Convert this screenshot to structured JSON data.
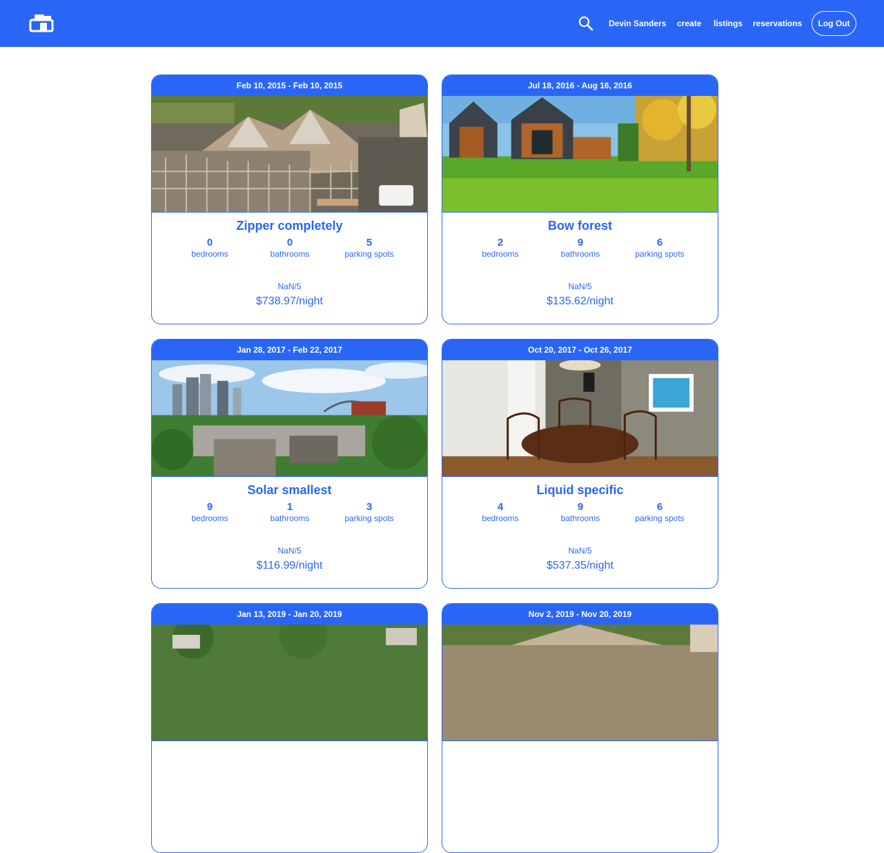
{
  "navbar": {
    "user_name": "Devin Sanders",
    "links": {
      "create": "create",
      "listings": "listings",
      "reservations": "reservations"
    },
    "logout_label": "Log Out",
    "accent_color": "#2a66f6"
  },
  "listings": [
    {
      "dates": "Feb 10, 2015 - Feb 10, 2015",
      "title": "Zipper completely",
      "bedrooms": "0",
      "bathrooms": "0",
      "parking": "5",
      "rating": "NaN/5",
      "price": "$738.97/night"
    },
    {
      "dates": "Jul 18, 2016 - Aug 16, 2016",
      "title": "Bow forest",
      "bedrooms": "2",
      "bathrooms": "9",
      "parking": "6",
      "rating": "NaN/5",
      "price": "$135.62/night"
    },
    {
      "dates": "Jan 28, 2017 - Feb 22, 2017",
      "title": "Solar smallest",
      "bedrooms": "9",
      "bathrooms": "1",
      "parking": "3",
      "rating": "NaN/5",
      "price": "$116.99/night"
    },
    {
      "dates": "Oct 20, 2017 - Oct 26, 2017",
      "title": "Liquid specific",
      "bedrooms": "4",
      "bathrooms": "9",
      "parking": "6",
      "rating": "NaN/5",
      "price": "$537.35/night"
    },
    {
      "dates": "Jan 13, 2019 - Jan 20, 2019"
    },
    {
      "dates": "Nov 2, 2019 - Nov 20, 2019"
    }
  ],
  "labels": {
    "bedrooms": "bedrooms",
    "bathrooms": "bathrooms",
    "parking": "parking spots"
  }
}
